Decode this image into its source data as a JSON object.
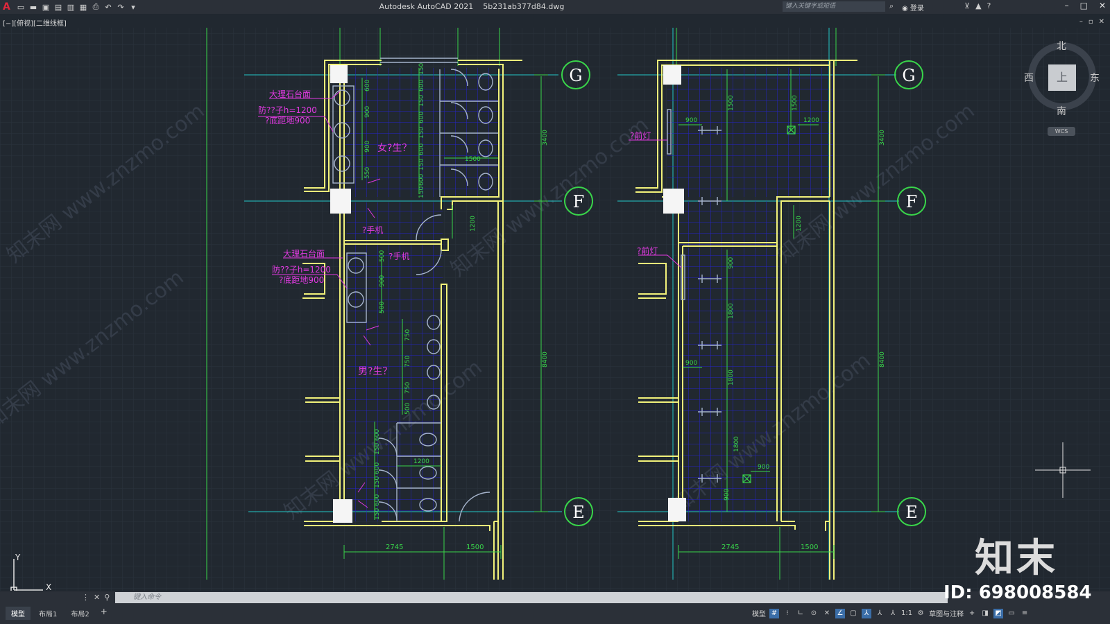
{
  "app": {
    "title": "Autodesk AutoCAD 2021",
    "file": "5b231ab377d84.dwg",
    "search_placeholder": "键入关键字或短语",
    "login_label": "登录",
    "view_label": "[−][俯视][二维线框]",
    "colors": {
      "background": "#212830",
      "grid": "#2c3440",
      "wall": "#f2f27a",
      "dim": "#39d64a",
      "axis": "#23c8c8",
      "tile": "#2323c8",
      "annotation": "#e23ae2",
      "fixture": "#a6b4cc",
      "circle": "#39d64a"
    }
  },
  "quick_access": [
    {
      "name": "new-file-icon",
      "glyph": "▭"
    },
    {
      "name": "open-file-icon",
      "glyph": "▬"
    },
    {
      "name": "save-icon",
      "glyph": "▣"
    },
    {
      "name": "save-as-icon",
      "glyph": "▤"
    },
    {
      "name": "web-open-icon",
      "glyph": "▥"
    },
    {
      "name": "web-save-icon",
      "glyph": "▦"
    },
    {
      "name": "print-icon",
      "glyph": "⎙"
    },
    {
      "name": "undo-icon",
      "glyph": "↶"
    },
    {
      "name": "redo-icon",
      "glyph": "↷"
    },
    {
      "name": "customize-icon",
      "glyph": "▾"
    }
  ],
  "viewcube": {
    "north": "北",
    "south": "南",
    "east": "东",
    "west": "西",
    "top": "上",
    "wcs": "WCS"
  },
  "drawing": {
    "left_plan": {
      "female_room": "女?生？",
      "male_room": "男?生？",
      "hand_dryer_1": "?手机",
      "hand_dryer_2": "?手机",
      "counter_1": "大理石台面",
      "counter_2": "大理石台面",
      "mirror_1a": "防??子h=1200",
      "mirror_1b": "?底距地900",
      "mirror_2a": "防??子h=1200",
      "mirror_2b": "?底距地900",
      "dims_vertical_left": [
        "600",
        "900",
        "900",
        "550",
        "500",
        "900",
        "500"
      ],
      "dims_stalls_top": [
        "150",
        "600",
        "150",
        "600",
        "150",
        "600",
        "150",
        "600",
        "150"
      ],
      "dims_urinals": [
        "750",
        "750",
        "750",
        "500"
      ],
      "dims_stalls_bottom": [
        "600",
        "150",
        "600",
        "150",
        "600",
        "150",
        "600",
        "150"
      ],
      "dim_1500": "1500",
      "dim_1200_a": "1200",
      "dim_1200_b": "1200",
      "dim_3400": "3400",
      "dim_8400": "8400",
      "dim_bottom_a": "2745",
      "dim_bottom_b": "1500"
    },
    "right_plan": {
      "light_1": "?前灯",
      "light_2": "?前灯",
      "dims": [
        "900",
        "1500",
        "1500",
        "1200",
        "1200",
        "900",
        "1800",
        "1800",
        "900",
        "1800",
        "900",
        "900"
      ],
      "dim_3400": "3400",
      "dim_8400": "8400",
      "dim_bottom_a": "2745",
      "dim_bottom_b": "1500"
    },
    "axis_labels": [
      "G",
      "F",
      "E"
    ]
  },
  "watermarks": [
    "知末网 www.znzmo.com"
  ],
  "command": {
    "placeholder": "键入命令"
  },
  "status": {
    "tabs": [
      "模型",
      "布局1",
      "布局2"
    ],
    "model_label": "模型",
    "scale": "1:1",
    "workspace": "草图与注释"
  },
  "branding": {
    "logo_text": "知末",
    "id_text": "ID: 698008584"
  }
}
